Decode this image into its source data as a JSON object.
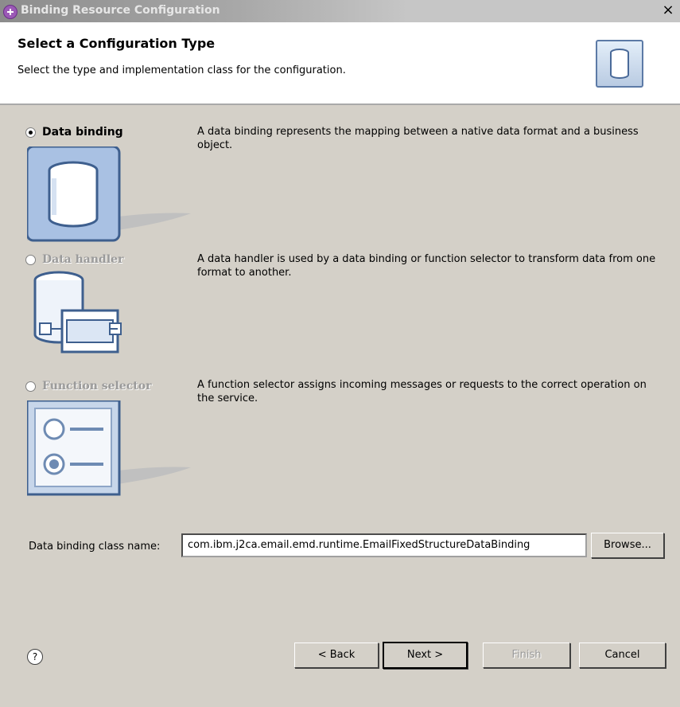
{
  "window": {
    "title": "Binding Resource Configuration",
    "close_glyph": "×"
  },
  "banner": {
    "heading": "Select a Configuration Type",
    "subheading": "Select the type and implementation class for the configuration.",
    "icon": "database-icon"
  },
  "options": [
    {
      "label": "Data binding",
      "selected": true,
      "enabled": true,
      "description": "A data binding represents the mapping between a native data format and a business object.",
      "icon": "data-binding-icon"
    },
    {
      "label": "Data handler",
      "selected": false,
      "enabled": false,
      "description": "A data handler is used by a data binding or function selector to transform data from one format to another.",
      "icon": "data-handler-icon"
    },
    {
      "label": "Function selector",
      "selected": false,
      "enabled": false,
      "description": "A function selector assigns incoming messages or requests to the correct operation on the service.",
      "icon": "function-selector-icon"
    }
  ],
  "class_field": {
    "label": "Data binding class name:",
    "value": "com.ibm.j2ca.email.emd.runtime.EmailFixedStructureDataBinding",
    "browse_label": "Browse..."
  },
  "footer": {
    "help_glyph": "?",
    "back_label": "< Back",
    "next_label": "Next >",
    "finish_label": "Finish",
    "cancel_label": "Cancel"
  },
  "colors": {
    "dialog_bg": "#d4d0c8",
    "banner_bg": "#ffffff",
    "icon_blue": "#5c7aa6",
    "disabled_text": "#9a9a9a"
  }
}
